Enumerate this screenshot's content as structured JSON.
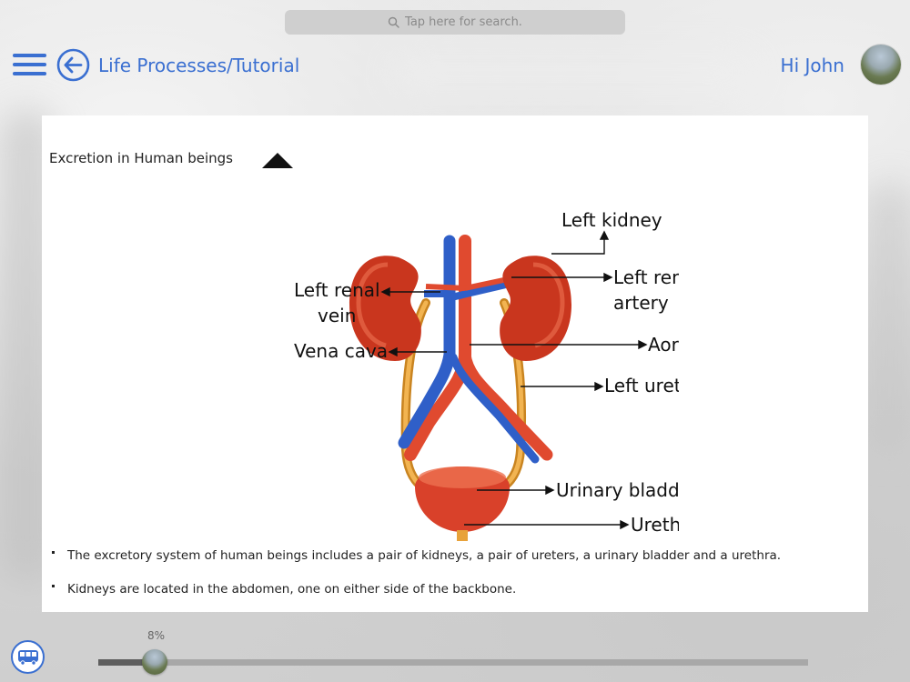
{
  "search": {
    "placeholder": "Tap here for search."
  },
  "header": {
    "breadcrumb": "Life Processes/Tutorial",
    "greeting": "Hi John"
  },
  "content": {
    "section_title": "Excretion in Human beings",
    "diagram_labels": {
      "left_kidney": "Left kidney",
      "left_renal_artery_1": "Left renal",
      "left_renal_artery_2": "artery",
      "left_renal_vein_1": "Left renal",
      "left_renal_vein_2": "vein",
      "vena_cava": "Vena cava",
      "aorta": "Aorta",
      "left_ureter": "Left ureter",
      "urinary_bladder": "Urinary bladder",
      "urethra": "Urethra"
    },
    "bullets": [
      "The excretory system of human beings includes a pair of kidneys, a pair of ureters, a urinary bladder and a urethra.",
      "Kidneys are located in the abdomen, one on either side of the backbone."
    ]
  },
  "progress": {
    "label": "8%",
    "value": 0.08
  },
  "colors": {
    "accent": "#3a6fd1",
    "artery": "#e04a2f",
    "vein": "#2f5fc8",
    "ureter": "#e8a23a",
    "kidney": "#c9361e"
  },
  "icons": {
    "menu": "hamburger-menu-icon",
    "back": "back-arrow-circle-icon",
    "search": "search-icon",
    "collapse": "triangle-up-icon",
    "bus": "bus-icon"
  }
}
